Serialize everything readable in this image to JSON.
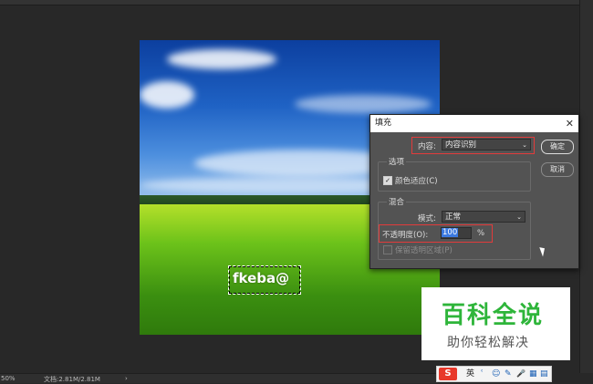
{
  "canvas": {
    "selection_text": "fkeba@"
  },
  "statusbar": {
    "zoom": "50%",
    "doc_info": "文档:2.81M/2.81M",
    "arrow": "›"
  },
  "fill_dialog": {
    "title": "填充",
    "close": "✕",
    "content_label": "内容:",
    "content_value": "内容识别",
    "ok_label": "确定",
    "cancel_label": "取消",
    "options_group": "选项",
    "color_adapt_label": "颜色适应(C)",
    "color_adapt_checked": true,
    "blending_group": "混合",
    "mode_label": "模式:",
    "mode_value": "正常",
    "opacity_label": "不透明度(O):",
    "opacity_value": "100",
    "opacity_unit": "%",
    "preserve_label": "保留透明区域(P)"
  },
  "watermark": {
    "title": "百科全说",
    "subtitle": "助你轻松解决"
  },
  "ime_toolbar": {
    "logo": "S",
    "lang": "英",
    "items": [
      "ʿ",
      "☺",
      "✎",
      "🎤",
      "▦",
      "▤"
    ]
  },
  "colors": {
    "accent_red": "#e23b3b",
    "selection_blue": "#3b79e0",
    "watermark_green": "#2eb53a"
  }
}
